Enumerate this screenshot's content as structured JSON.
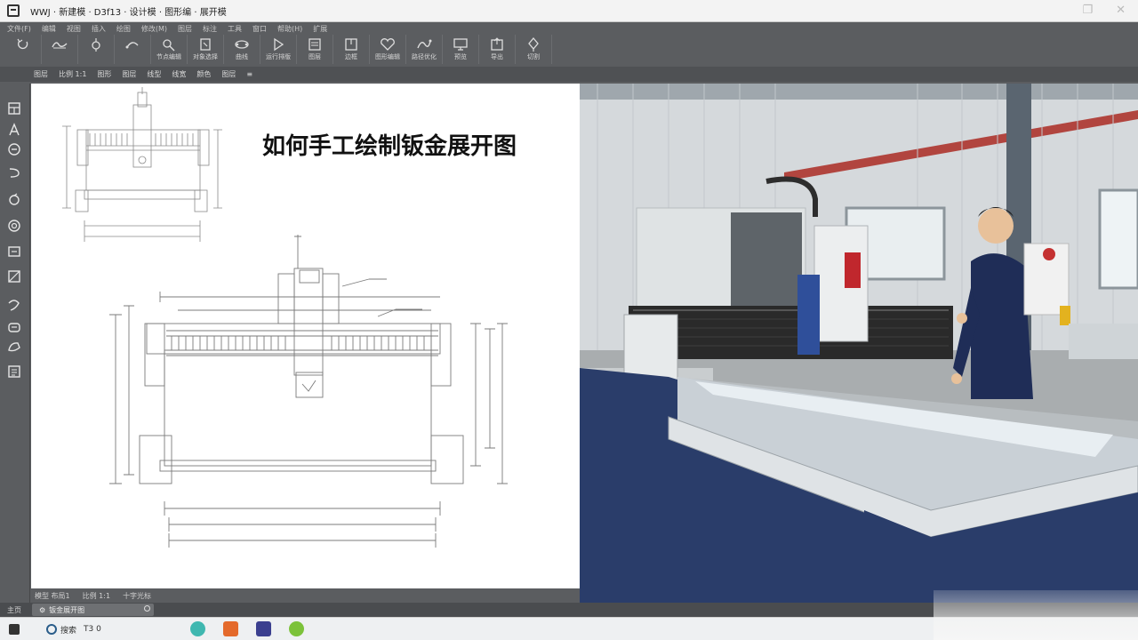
{
  "window": {
    "title": "WWJ · 新建模 · D3f13 · 设计模 · 图形编 · 展开模"
  },
  "menubar": {
    "items": [
      "文件(F)",
      "编辑",
      "视图",
      "插入",
      "绘图",
      "修改(M)",
      "图层",
      "标注",
      "工具",
      "窗口",
      "帮助(H)",
      "扩展"
    ]
  },
  "toolbar": {
    "tools": [
      {
        "icon": "rotate-icon",
        "label": ""
      },
      {
        "icon": "freehand-icon",
        "label": ""
      },
      {
        "icon": "pen-icon",
        "label": ""
      },
      {
        "icon": "curve-icon",
        "label": ""
      },
      {
        "icon": "node-edit-icon",
        "label": "节点编辑"
      },
      {
        "icon": "select-icon",
        "label": "对象选择"
      },
      {
        "icon": "bezier-icon",
        "label": "曲线"
      },
      {
        "icon": "play-icon",
        "label": "运行排版"
      },
      {
        "icon": "layer-icon",
        "label": "图层"
      },
      {
        "icon": "frame-icon",
        "label": "边框"
      },
      {
        "icon": "heart-shape-icon",
        "label": "图形编辑"
      },
      {
        "icon": "path-icon",
        "label": "路径优化"
      },
      {
        "icon": "monitor-icon",
        "label": "预览"
      },
      {
        "icon": "export-icon",
        "label": "导出"
      },
      {
        "icon": "compass-icon",
        "label": "切割"
      }
    ]
  },
  "subbar": {
    "items": [
      "图层",
      "比例 1:1",
      "图形",
      "图层",
      "线型",
      "线宽",
      "颜色",
      "图层",
      "≡"
    ]
  },
  "left_tools": [
    "table-icon",
    "text-icon",
    "circle-minus-icon",
    "arc-icon",
    "circle-icon",
    "ellipse-icon",
    "rectangle-icon",
    "polygon-icon",
    "spline-icon",
    "hatch-icon",
    "region-icon",
    "block-icon"
  ],
  "document": {
    "title": "如何手工绘制钣金展开图"
  },
  "statusbar": {
    "items": [
      "模型 布局1",
      "比例 1:1",
      "十字光标"
    ]
  },
  "docbar": {
    "home": "主页",
    "tab_label": "钣金展开图"
  },
  "taskbar": {
    "items": [
      {
        "label": ""
      },
      {
        "label": "搜索"
      },
      {
        "label": "T3 0"
      }
    ]
  },
  "colors": {
    "chrome": "#5b5d60",
    "canvas": "#ffffff",
    "accent": "#2a3d6a"
  }
}
